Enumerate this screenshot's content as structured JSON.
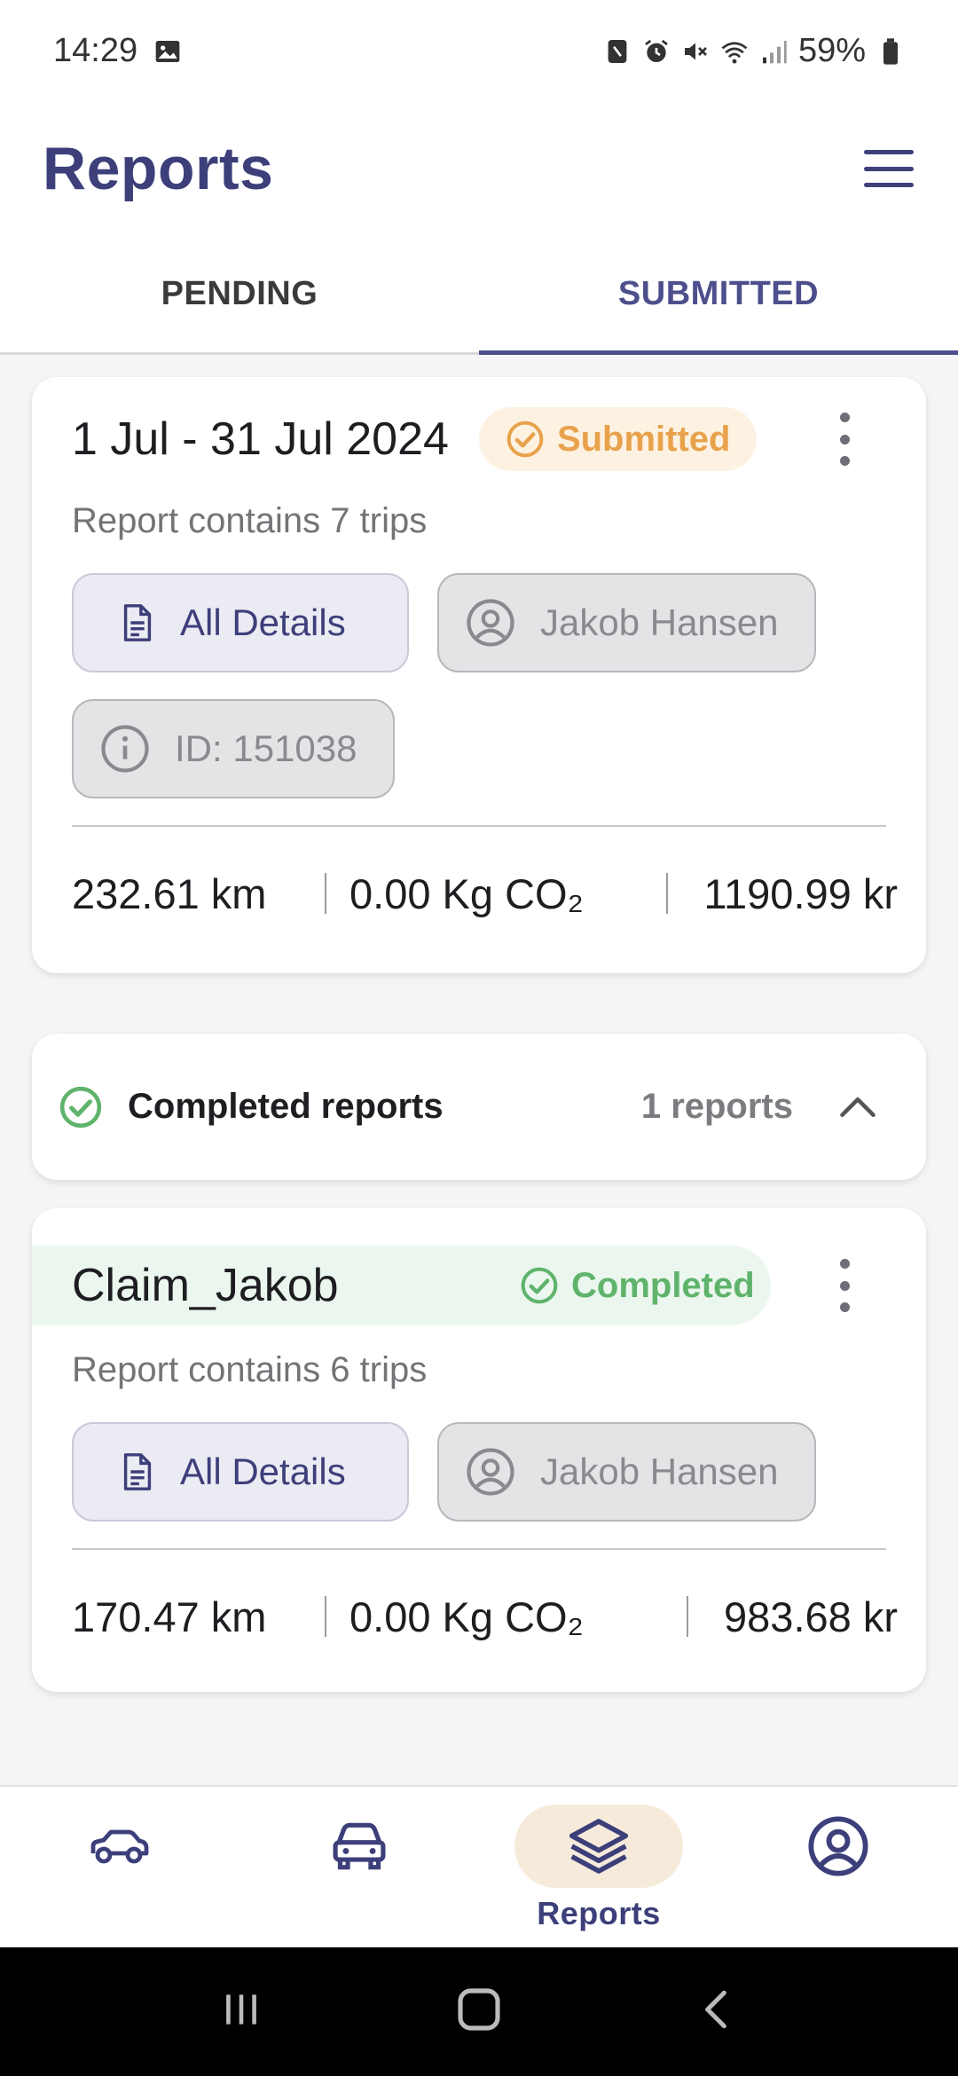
{
  "status_bar": {
    "time": "14:29",
    "battery": "59%",
    "icons": [
      "image-icon",
      "nfc-icon",
      "alarm-icon",
      "mute-icon",
      "wifi-icon",
      "signal-icon",
      "battery-icon"
    ]
  },
  "header": {
    "title": "Reports",
    "menu_icon": "hamburger-menu-icon"
  },
  "tabs": [
    {
      "label": "PENDING",
      "active": false
    },
    {
      "label": "SUBMITTED",
      "active": true
    }
  ],
  "submitted_report": {
    "title": "1 Jul - 31 Jul 2024",
    "badge": "Submitted",
    "subtitle": "Report contains 7 trips",
    "details_label": "All Details",
    "user": "Jakob Hansen",
    "id_label": "ID: 151038",
    "distance": "232.61 km",
    "co2": "0.00 Kg CO₂",
    "amount": "1190.99 kr"
  },
  "completed_section": {
    "label": "Completed reports",
    "count": "1 reports"
  },
  "completed_report": {
    "title": "Claim_Jakob",
    "badge": "Completed",
    "subtitle": "Report contains 6 trips",
    "details_label": "All Details",
    "user": "Jakob Hansen",
    "distance": "170.47 km",
    "co2": "0.00 Kg CO₂",
    "amount": "983.68 kr"
  },
  "bottom_nav": [
    {
      "icon": "car-side-icon",
      "label": ""
    },
    {
      "icon": "car-front-icon",
      "label": ""
    },
    {
      "icon": "layers-icon",
      "label": "Reports",
      "active": true
    },
    {
      "icon": "profile-icon",
      "label": ""
    }
  ],
  "colors": {
    "brand": "#3d3f7a",
    "submitted": "#e8a24c",
    "completed": "#5fb36b"
  }
}
